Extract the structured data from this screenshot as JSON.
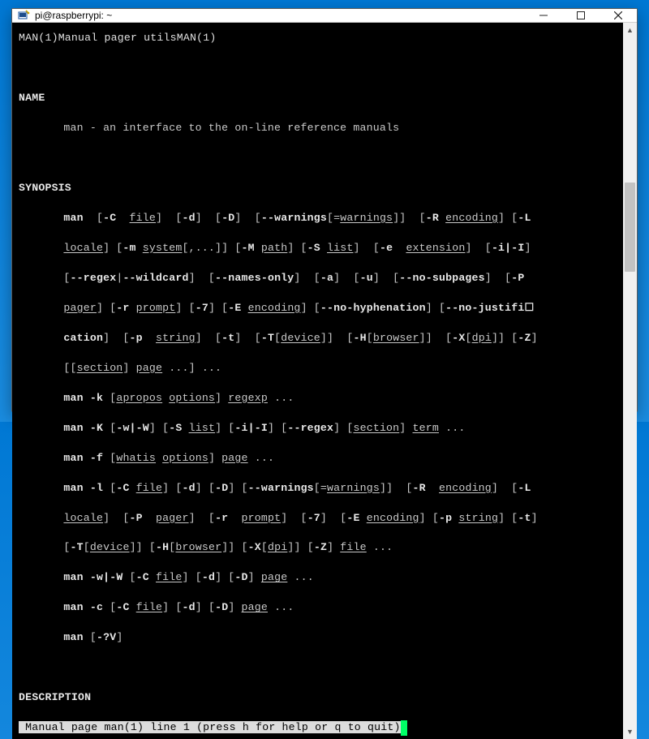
{
  "window": {
    "title": "pi@raspberrypi: ~"
  },
  "manpage": {
    "header_left": "MAN(1)",
    "header_center": "Manual pager utils",
    "header_right": "MAN(1)",
    "section_name": "NAME",
    "name_line": "man - an interface to the on-line reference manuals",
    "section_synopsis": "SYNOPSIS",
    "syn": {
      "cmd": "man",
      "opts": {
        "C": "-C",
        "file": "file",
        "d": "-d",
        "D": "-D",
        "warnings": "--warnings",
        "warnings_arg": "warnings",
        "R": "-R",
        "encoding": "encoding",
        "L": "-L",
        "locale": "locale",
        "m": "-m",
        "system": "system",
        "M": "-M",
        "path": "path",
        "S": "-S",
        "list": "list",
        "e": "-e",
        "extension": "extension",
        "iI": "-i|-I",
        "regex": "--regex",
        "wildcard": "--wildcard",
        "names_only": "--names-only",
        "a": "-a",
        "u": "-u",
        "no_subpages": "--no-subpages",
        "P": "-P",
        "pager": "pager",
        "r": "-r",
        "prompt": "prompt",
        "seven": "-7",
        "E": "-E",
        "no_hyph": "--no-hyphenation",
        "no_just": "--no-justifi☐",
        "cation": "cation",
        "p": "-p",
        "string": "string",
        "t": "-t",
        "T": "-T",
        "device": "device",
        "H": "-H",
        "browser": "browser",
        "X": "-X",
        "dpi": "dpi",
        "Z": "-Z",
        "section": "section",
        "page": "page",
        "dots": "...",
        "k": "-k",
        "apropos": "apropos",
        "options": "options",
        "regexp": "regexp",
        "K": "-K",
        "wW": "-w|-W",
        "term": "term",
        "f": "-f",
        "whatis": "whatis",
        "l": "-l",
        "c": "-c",
        "qv": "-?V"
      }
    },
    "section_description": "DESCRIPTION",
    "status_line": " Manual page man(1) line 1 (press h for help or q to quit)"
  }
}
